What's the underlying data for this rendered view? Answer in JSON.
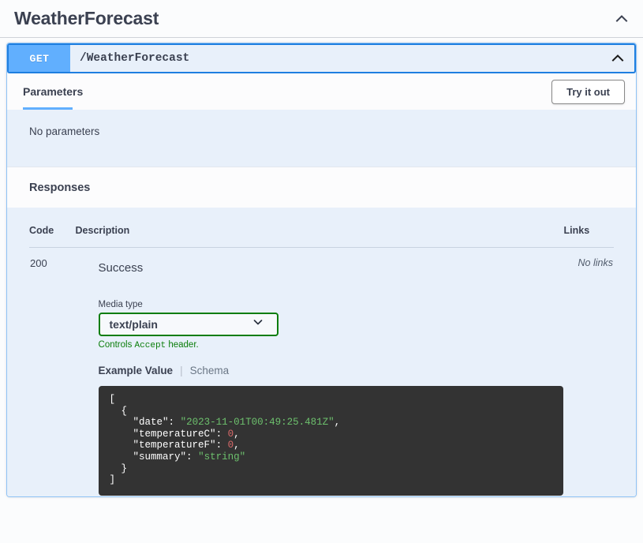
{
  "tag": {
    "title": "WeatherForecast",
    "collapse_icon": "chevron-up-icon"
  },
  "operation": {
    "method": "GET",
    "path": "/WeatherForecast",
    "collapse_icon": "chevron-up-icon"
  },
  "tabs": {
    "parameters_label": "Parameters",
    "try_it_out_label": "Try it out",
    "no_parameters_text": "No parameters"
  },
  "responses": {
    "title": "Responses",
    "columns": {
      "code": "Code",
      "description": "Description",
      "links": "Links"
    },
    "rows": [
      {
        "code": "200",
        "description": "Success",
        "links": "No links"
      }
    ]
  },
  "media": {
    "label": "Media type",
    "selected": "text/plain",
    "dropdown_icon": "chevron-down-icon",
    "hint_prefix": "Controls ",
    "hint_mono": "Accept",
    "hint_suffix": " header."
  },
  "example": {
    "active_tab": "Example Value",
    "separator": "|",
    "inactive_tab": "Schema",
    "json_lines": [
      {
        "indent": 0,
        "parts": [
          {
            "t": "[",
            "c": "pun"
          }
        ]
      },
      {
        "indent": 1,
        "parts": [
          {
            "t": "{",
            "c": "pun"
          }
        ]
      },
      {
        "indent": 2,
        "parts": [
          {
            "t": "\"date\"",
            "c": "k"
          },
          {
            "t": ": ",
            "c": "pun"
          },
          {
            "t": "\"2023-11-01T00:49:25.481Z\"",
            "c": "str"
          },
          {
            "t": ",",
            "c": "pun"
          }
        ]
      },
      {
        "indent": 2,
        "parts": [
          {
            "t": "\"temperatureC\"",
            "c": "k"
          },
          {
            "t": ": ",
            "c": "pun"
          },
          {
            "t": "0",
            "c": "num"
          },
          {
            "t": ",",
            "c": "pun"
          }
        ]
      },
      {
        "indent": 2,
        "parts": [
          {
            "t": "\"temperatureF\"",
            "c": "k"
          },
          {
            "t": ": ",
            "c": "pun"
          },
          {
            "t": "0",
            "c": "num"
          },
          {
            "t": ",",
            "c": "pun"
          }
        ]
      },
      {
        "indent": 2,
        "parts": [
          {
            "t": "\"summary\"",
            "c": "k"
          },
          {
            "t": ": ",
            "c": "pun"
          },
          {
            "t": "\"string\"",
            "c": "str"
          }
        ]
      },
      {
        "indent": 1,
        "parts": [
          {
            "t": "}",
            "c": "pun"
          }
        ]
      },
      {
        "indent": 0,
        "parts": [
          {
            "t": "]",
            "c": "pun"
          }
        ]
      }
    ]
  },
  "colors": {
    "get_method": "#61affe",
    "opblock_border": "#1f7fe0",
    "opblock_bg": "#e8f0fa",
    "tab_underline": "#61affe",
    "media_border": "#0a7d0a",
    "media_hint_text": "#0a7d0a",
    "code_bg": "#333333",
    "code_string": "#6dc06d",
    "code_number": "#d96a6a"
  }
}
